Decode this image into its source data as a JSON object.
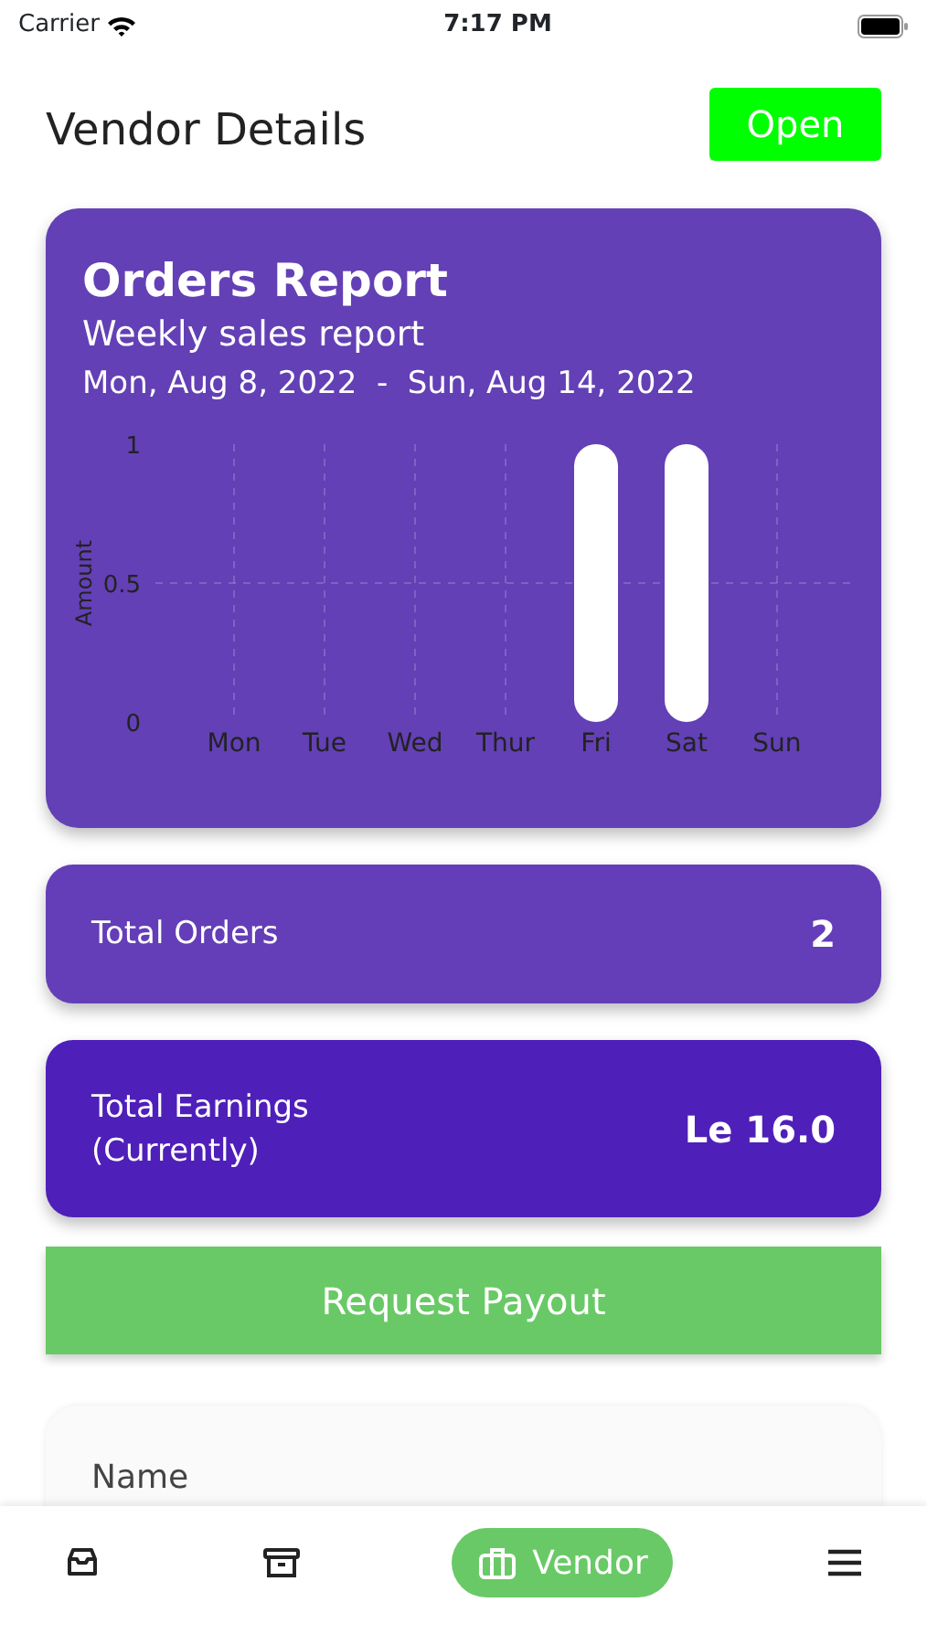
{
  "status_bar": {
    "carrier": "Carrier",
    "time": "7:17 PM"
  },
  "header": {
    "title": "Vendor Details",
    "status_button": "Open"
  },
  "report": {
    "title": "Orders Report",
    "subtitle": "Weekly sales report",
    "date_range": "Mon, Aug 8, 2022  -  Sun, Aug 14, 2022",
    "chart_data": {
      "type": "bar",
      "ylabel": "Amount",
      "categories": [
        "Mon",
        "Tue",
        "Wed",
        "Thur",
        "Fri",
        "Sat",
        "Sun"
      ],
      "values": [
        0,
        0,
        0,
        0,
        1,
        1,
        0
      ],
      "ylim": [
        0,
        1
      ],
      "yticks": [
        0,
        0.5,
        1
      ],
      "grid": true
    }
  },
  "stats": [
    {
      "label": "Total Orders",
      "value": "2",
      "kind": "orders"
    },
    {
      "label": "Total Earnings\n(Currently)",
      "value": "Le 16.0",
      "kind": "earnings"
    }
  ],
  "payout_button": "Request Payout",
  "info_card": {
    "label": "Name"
  },
  "bottom_nav": [
    {
      "kind": "inbox",
      "selected": false
    },
    {
      "kind": "archive",
      "selected": false
    },
    {
      "kind": "briefcase",
      "label": "Vendor",
      "selected": true
    },
    {
      "kind": "menu",
      "selected": false
    }
  ]
}
